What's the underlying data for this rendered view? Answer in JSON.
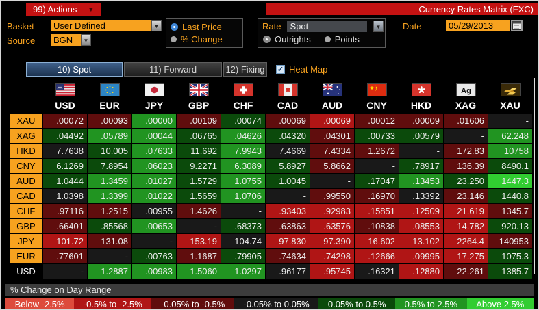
{
  "titlebar": {
    "actions_label": "99) Actions",
    "title": "Currency Rates Matrix (FXC)"
  },
  "controls": {
    "basket_label": "Basket",
    "basket_value": "User Defined",
    "source_label": "Source",
    "source_value": "BGN",
    "price_mode": {
      "options": [
        {
          "label": "Last Price",
          "selected": true
        },
        {
          "label": "% Change",
          "selected": false
        }
      ]
    },
    "rate_label": "Rate",
    "rate_value": "Spot",
    "outright_mode": {
      "options": [
        {
          "label": "Outrights",
          "selected": true
        },
        {
          "label": "Points",
          "selected": false
        }
      ]
    },
    "date_label": "Date",
    "date_value": "05/29/2013"
  },
  "tabs": [
    {
      "label": "10) Spot",
      "selected": true
    },
    {
      "label": "11) Forward",
      "selected": false
    },
    {
      "label": "12) Fixing",
      "selected": false
    }
  ],
  "heat_map": {
    "label": "Heat Map",
    "checked": true
  },
  "heat_colors": {
    "r3": "#dd4b3c",
    "r2": "#b01515",
    "r1": "#600d0d",
    "z": "#191919",
    "g1": "#0b4a0b",
    "g2": "#219421",
    "g3": "#31cd31"
  },
  "matrix": {
    "columns": [
      {
        "code": "USD",
        "icon": "us-flag-icon"
      },
      {
        "code": "EUR",
        "icon": "eu-flag-icon"
      },
      {
        "code": "JPY",
        "icon": "japan-flag-icon"
      },
      {
        "code": "GBP",
        "icon": "uk-flag-icon"
      },
      {
        "code": "CHF",
        "icon": "switzerland-flag-icon"
      },
      {
        "code": "CAD",
        "icon": "canada-flag-icon"
      },
      {
        "code": "AUD",
        "icon": "australia-flag-icon"
      },
      {
        "code": "CNY",
        "icon": "china-flag-icon"
      },
      {
        "code": "HKD",
        "icon": "hong-kong-flag-icon"
      },
      {
        "code": "XAG",
        "icon": "silver-icon",
        "icon_text": "Ag"
      },
      {
        "code": "XAU",
        "icon": "gold-icon"
      }
    ],
    "rows": [
      {
        "label": "XAU",
        "style": "amber",
        "cells": [
          [
            ".00072",
            "r1"
          ],
          [
            ".00093",
            "r1"
          ],
          [
            ".00000",
            "g2"
          ],
          [
            ".00109",
            "r1"
          ],
          [
            ".00074",
            "g1"
          ],
          [
            ".00069",
            "r1"
          ],
          [
            ".00069",
            "r2"
          ],
          [
            ".00012",
            "r1"
          ],
          [
            ".00009",
            "r1"
          ],
          [
            ".01606",
            "r1"
          ],
          [
            "-",
            "z"
          ]
        ]
      },
      {
        "label": "XAG",
        "style": "amber",
        "cells": [
          [
            ".04492",
            "g1"
          ],
          [
            ".05789",
            "g2"
          ],
          [
            ".00044",
            "g2"
          ],
          [
            ".06765",
            "g1"
          ],
          [
            ".04626",
            "g2"
          ],
          [
            ".04320",
            "g1"
          ],
          [
            ".04301",
            "r1"
          ],
          [
            ".00733",
            "g1"
          ],
          [
            ".00579",
            "g1"
          ],
          [
            "-",
            "z"
          ],
          [
            "62.248",
            "g2"
          ]
        ]
      },
      {
        "label": "HKD",
        "style": "amber",
        "cells": [
          [
            "7.7638",
            "z"
          ],
          [
            "10.005",
            "g1"
          ],
          [
            ".07633",
            "g2"
          ],
          [
            "11.692",
            "g1"
          ],
          [
            "7.9943",
            "g2"
          ],
          [
            "7.4669",
            "z"
          ],
          [
            "7.4334",
            "r1"
          ],
          [
            "1.2672",
            "r1"
          ],
          [
            "-",
            "z"
          ],
          [
            "172.83",
            "r1"
          ],
          [
            "10758",
            "g2"
          ]
        ]
      },
      {
        "label": "CNY",
        "style": "amber",
        "cells": [
          [
            "6.1269",
            "g1"
          ],
          [
            "7.8954",
            "g1"
          ],
          [
            ".06023",
            "g2"
          ],
          [
            "9.2271",
            "g1"
          ],
          [
            "6.3089",
            "g2"
          ],
          [
            "5.8927",
            "g1"
          ],
          [
            "5.8662",
            "r1"
          ],
          [
            "-",
            "z"
          ],
          [
            ".78917",
            "g1"
          ],
          [
            "136.39",
            "r1"
          ],
          [
            "8490.1",
            "g1"
          ]
        ]
      },
      {
        "label": "AUD",
        "style": "amber",
        "cells": [
          [
            "1.0444",
            "g1"
          ],
          [
            "1.3459",
            "g2"
          ],
          [
            ".01027",
            "g2"
          ],
          [
            "1.5729",
            "g1"
          ],
          [
            "1.0755",
            "g2"
          ],
          [
            "1.0045",
            "g1"
          ],
          [
            "-",
            "z"
          ],
          [
            ".17047",
            "g1"
          ],
          [
            ".13453",
            "g2"
          ],
          [
            "23.250",
            "g1"
          ],
          [
            "1447.3",
            "g3"
          ]
        ]
      },
      {
        "label": "CAD",
        "style": "amber",
        "cells": [
          [
            "1.0398",
            "z"
          ],
          [
            "1.3399",
            "g2"
          ],
          [
            ".01022",
            "g2"
          ],
          [
            "1.5659",
            "g1"
          ],
          [
            "1.0706",
            "g2"
          ],
          [
            "-",
            "z"
          ],
          [
            ".99550",
            "r1"
          ],
          [
            ".16970",
            "r1"
          ],
          [
            ".13392",
            "z"
          ],
          [
            "23.146",
            "r1"
          ],
          [
            "1440.8",
            "g1"
          ]
        ]
      },
      {
        "label": "CHF",
        "style": "amber",
        "cells": [
          [
            ".97116",
            "r1"
          ],
          [
            "1.2515",
            "r1"
          ],
          [
            ".00955",
            "z"
          ],
          [
            "1.4626",
            "r1"
          ],
          [
            "-",
            "z"
          ],
          [
            ".93403",
            "r2"
          ],
          [
            ".92983",
            "r2"
          ],
          [
            ".15851",
            "r2"
          ],
          [
            ".12509",
            "r2"
          ],
          [
            "21.619",
            "r2"
          ],
          [
            "1345.7",
            "r1"
          ]
        ]
      },
      {
        "label": "GBP",
        "style": "amber",
        "cells": [
          [
            ".66401",
            "r1"
          ],
          [
            ".85568",
            "g1"
          ],
          [
            ".00653",
            "g2"
          ],
          [
            "-",
            "z"
          ],
          [
            ".68373",
            "g1"
          ],
          [
            ".63863",
            "r1"
          ],
          [
            ".63576",
            "r2"
          ],
          [
            ".10838",
            "r1"
          ],
          [
            ".08553",
            "r2"
          ],
          [
            "14.782",
            "r2"
          ],
          [
            "920.13",
            "g1"
          ]
        ]
      },
      {
        "label": "JPY",
        "style": "amber",
        "cells": [
          [
            "101.72",
            "r2"
          ],
          [
            "131.08",
            "r1"
          ],
          [
            "-",
            "z"
          ],
          [
            "153.19",
            "r2"
          ],
          [
            "104.74",
            "z"
          ],
          [
            "97.830",
            "r2"
          ],
          [
            "97.390",
            "r2"
          ],
          [
            "16.602",
            "r2"
          ],
          [
            "13.102",
            "r2"
          ],
          [
            "2264.4",
            "r2"
          ],
          [
            "140953",
            "r1"
          ]
        ]
      },
      {
        "label": "EUR",
        "style": "amber",
        "cells": [
          [
            ".77601",
            "r1"
          ],
          [
            "-",
            "z"
          ],
          [
            ".00763",
            "g1"
          ],
          [
            "1.1687",
            "r1"
          ],
          [
            ".79905",
            "g1"
          ],
          [
            ".74634",
            "r1"
          ],
          [
            ".74298",
            "r2"
          ],
          [
            ".12666",
            "r2"
          ],
          [
            ".09995",
            "r2"
          ],
          [
            "17.275",
            "r2"
          ],
          [
            "1075.3",
            "g1"
          ]
        ]
      },
      {
        "label": "USD",
        "style": "plain",
        "cells": [
          [
            "-",
            "z"
          ],
          [
            "1.2887",
            "g2"
          ],
          [
            ".00983",
            "g2"
          ],
          [
            "1.5060",
            "g2"
          ],
          [
            "1.0297",
            "g2"
          ],
          [
            ".96177",
            "z"
          ],
          [
            ".95745",
            "r2"
          ],
          [
            ".16321",
            "z"
          ],
          [
            ".12880",
            "r2"
          ],
          [
            "22.261",
            "r1"
          ],
          [
            "1385.7",
            "g1"
          ]
        ]
      }
    ]
  },
  "legend": {
    "title": "% Change on Day Range",
    "items": [
      {
        "label": "Below -2.5%",
        "color_key": "r3"
      },
      {
        "label": "-0.5% to -2.5%",
        "color_key": "r2"
      },
      {
        "label": "-0.05% to -0.5%",
        "color_key": "r1"
      },
      {
        "label": "-0.05% to 0.05%",
        "color_key": "z"
      },
      {
        "label": "0.05% to 0.5%",
        "color_key": "g1"
      },
      {
        "label": "0.5% to 2.5%",
        "color_key": "g2"
      },
      {
        "label": "Above 2.5%",
        "color_key": "g3"
      }
    ]
  }
}
